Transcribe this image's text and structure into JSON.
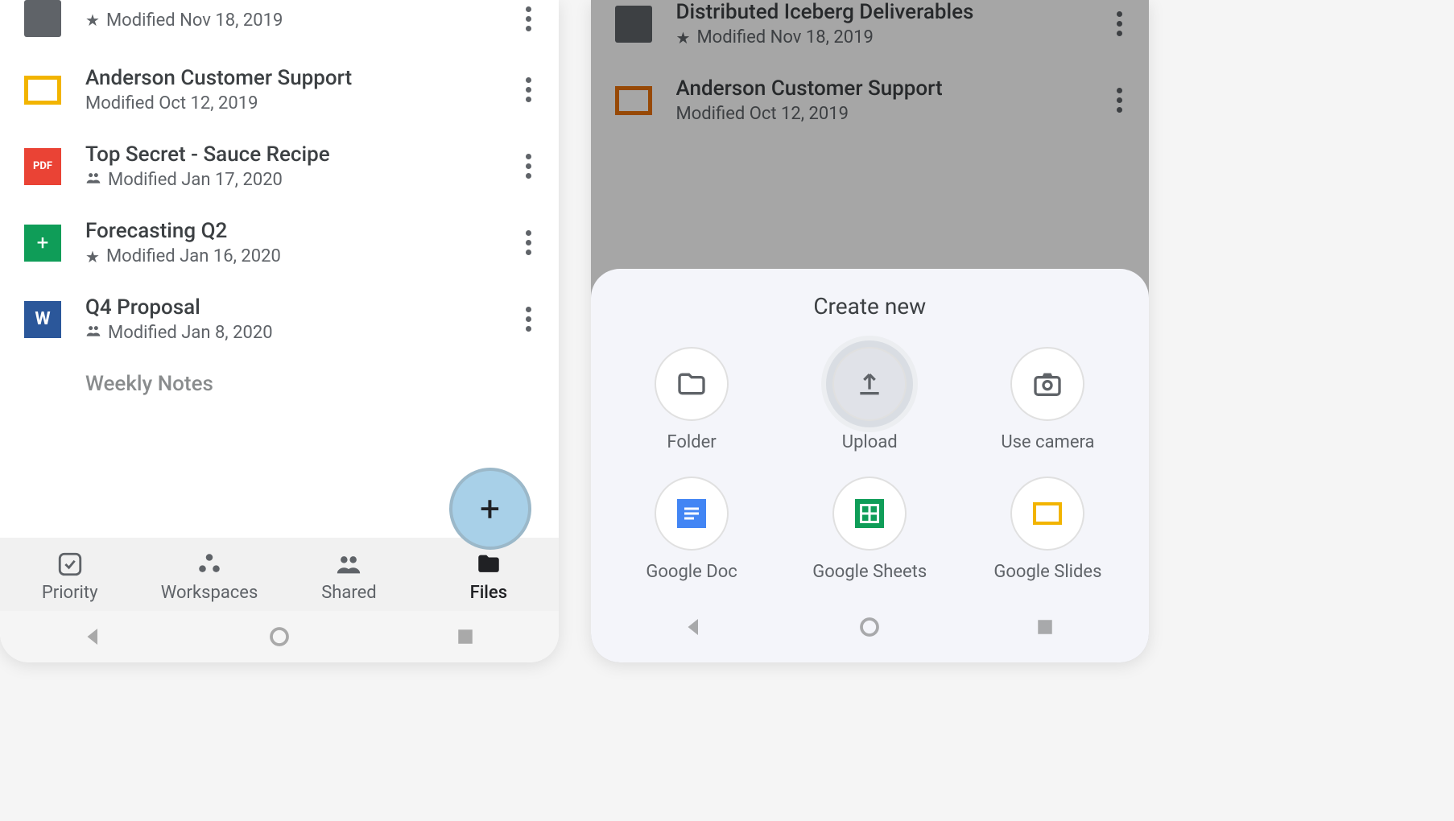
{
  "left": {
    "files": [
      {
        "title": "",
        "sub": "Modified Nov 18, 2019",
        "indicator": "star",
        "type": "folder"
      },
      {
        "title": "Anderson Customer Support",
        "sub": "Modified Oct 12, 2019",
        "indicator": "",
        "type": "slides"
      },
      {
        "title": "Top Secret - Sauce Recipe",
        "sub": "Modified Jan 17, 2020",
        "indicator": "shared",
        "type": "pdf"
      },
      {
        "title": "Forecasting Q2",
        "sub": "Modified Jan 16, 2020",
        "indicator": "star",
        "type": "sheets"
      },
      {
        "title": "Q4 Proposal",
        "sub": "Modified Jan 8, 2020",
        "indicator": "shared",
        "type": "word"
      },
      {
        "title": "Weekly Notes",
        "sub": "",
        "indicator": "",
        "type": ""
      }
    ],
    "tabs": {
      "priority": "Priority",
      "workspaces": "Workspaces",
      "shared": "Shared",
      "files": "Files"
    },
    "fab": "+"
  },
  "right": {
    "bg_files": [
      {
        "title": "Distributed Iceberg Deliverables",
        "sub": "Modified Nov 18, 2019",
        "indicator": "star",
        "type": "folder"
      },
      {
        "title": "Anderson Customer Support",
        "sub": "Modified Oct 12, 2019",
        "indicator": "",
        "type": "slides-orange"
      }
    ],
    "sheet": {
      "title": "Create new",
      "options": {
        "folder": "Folder",
        "upload": "Upload",
        "camera": "Use camera",
        "doc": "Google Doc",
        "sheets": "Google Sheets",
        "slides": "Google Slides"
      }
    }
  },
  "pdf_label": "PDF",
  "word_label": "W",
  "sheets_glyph": "+"
}
